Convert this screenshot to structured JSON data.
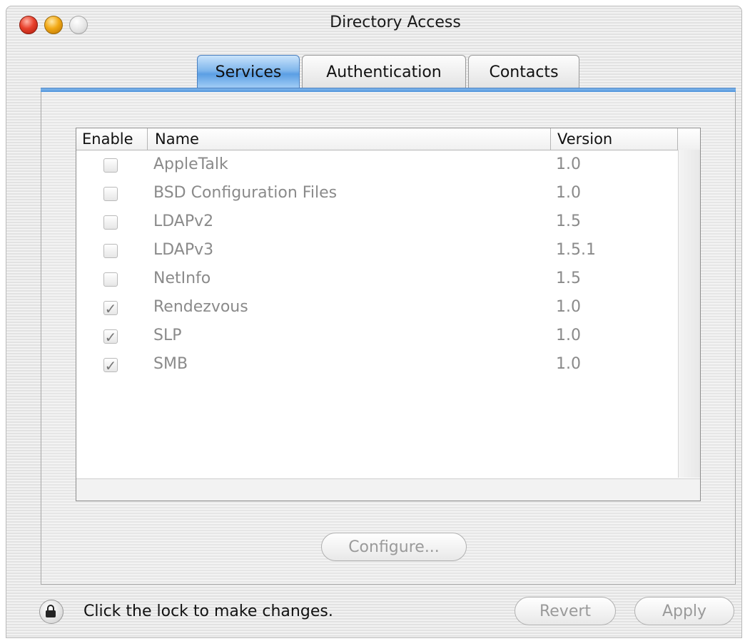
{
  "window": {
    "title": "Directory Access"
  },
  "tabs": [
    {
      "label": "Services",
      "selected": true
    },
    {
      "label": "Authentication",
      "selected": false
    },
    {
      "label": "Contacts",
      "selected": false
    }
  ],
  "table": {
    "columns": [
      "Enable",
      "Name",
      "Version"
    ],
    "rows": [
      {
        "enabled": false,
        "name": "AppleTalk",
        "version": "1.0"
      },
      {
        "enabled": false,
        "name": "BSD Configuration Files",
        "version": "1.0"
      },
      {
        "enabled": false,
        "name": "LDAPv2",
        "version": "1.5"
      },
      {
        "enabled": false,
        "name": "LDAPv3",
        "version": "1.5.1"
      },
      {
        "enabled": false,
        "name": "NetInfo",
        "version": "1.5"
      },
      {
        "enabled": true,
        "name": "Rendezvous",
        "version": "1.0"
      },
      {
        "enabled": true,
        "name": "SLP",
        "version": "1.0"
      },
      {
        "enabled": true,
        "name": "SMB",
        "version": "1.0"
      }
    ]
  },
  "buttons": {
    "configure": "Configure...",
    "revert": "Revert",
    "apply": "Apply"
  },
  "footer": {
    "lock_text": "Click the lock to make changes."
  },
  "icons": {
    "lock": "lock-icon",
    "check": "✓"
  },
  "colors": {
    "tab_selected": "#5b9fe4",
    "disabled_text": "#8a8a8a"
  }
}
